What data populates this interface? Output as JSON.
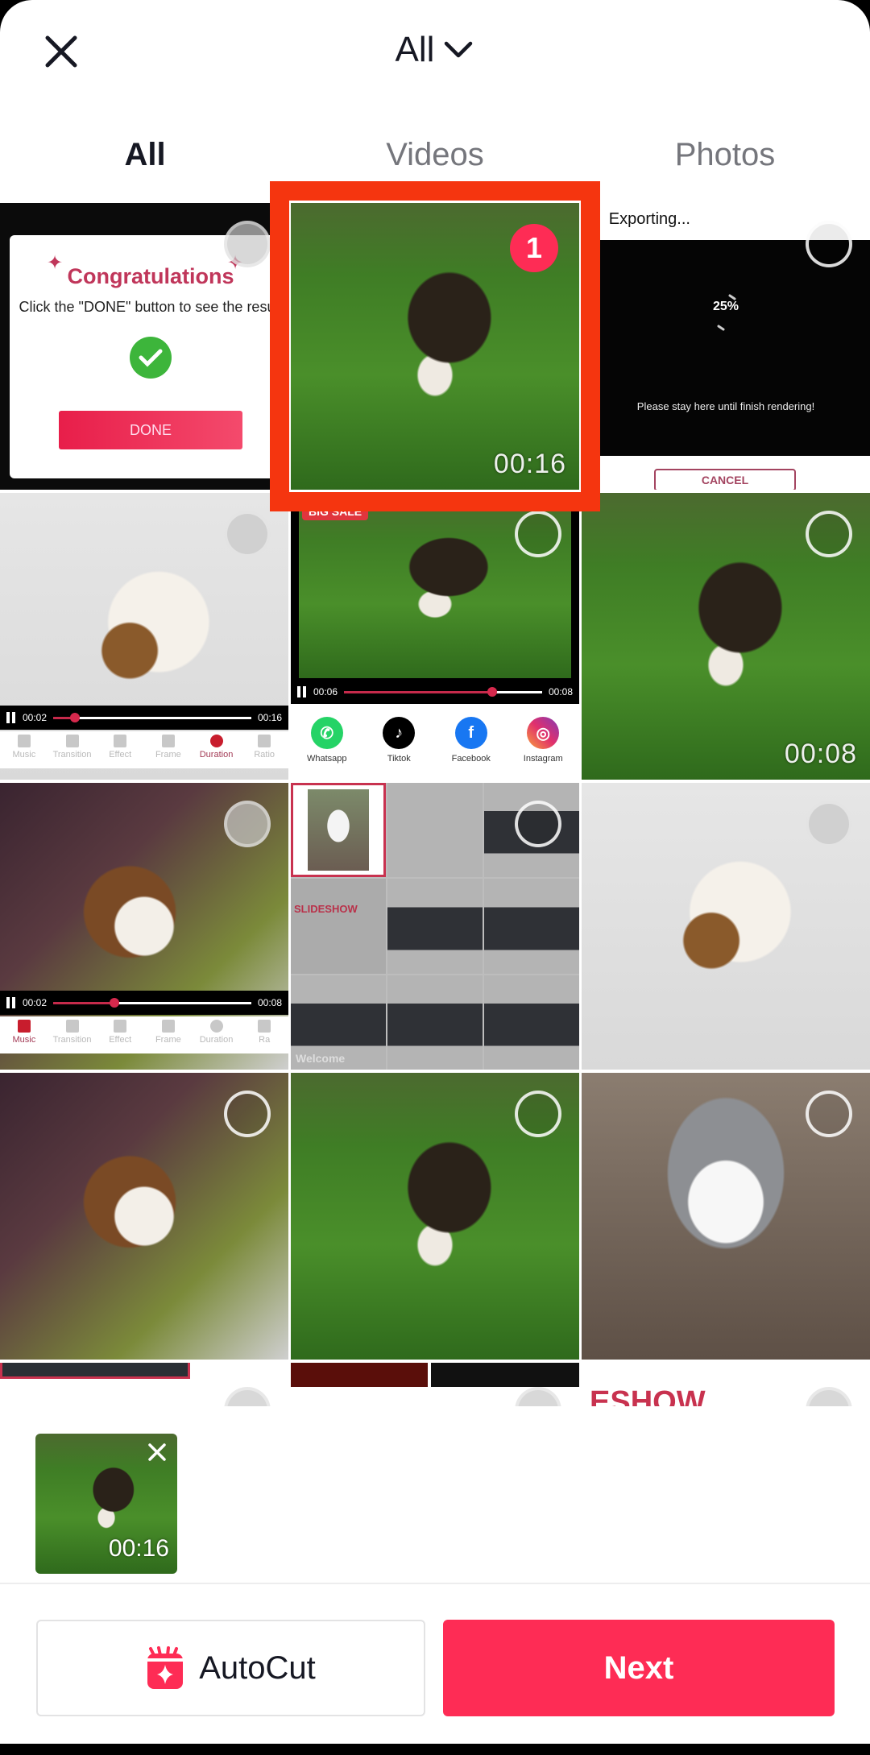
{
  "header": {
    "close_icon": "close-icon",
    "album_title": "All",
    "album_chevron": "chevron-down-icon"
  },
  "tabs": [
    {
      "label": "All",
      "active": true
    },
    {
      "label": "Videos",
      "active": false
    },
    {
      "label": "Photos",
      "active": false
    }
  ],
  "grid": {
    "cells": [
      {
        "type": "screenshot",
        "content": {
          "title": "Congratulations",
          "subtitle": "Click the \"DONE\" button to see the result",
          "button": "DONE"
        },
        "selected": false
      },
      {
        "type": "video",
        "duration": "00:16",
        "selected": true,
        "selection_index": "1"
      },
      {
        "type": "screenshot",
        "content": {
          "header": "Exporting...",
          "progress": "25%",
          "message": "Please stay here until finish rendering!",
          "button": "CANCEL"
        },
        "selected": false
      },
      {
        "type": "screenshot",
        "content": {
          "current_time": "00:02",
          "total_time": "00:16",
          "playback_progress": 0.11,
          "tools": [
            "Music",
            "Transition",
            "Effect",
            "Frame",
            "Duration",
            "Ratio"
          ],
          "active_tool": "Duration"
        },
        "selected": false
      },
      {
        "type": "screenshot",
        "content": {
          "badge": "BIG SALE",
          "current_time": "00:06",
          "total_time": "00:08",
          "playback_progress": 0.75,
          "share_targets": [
            "Whatsapp",
            "Tiktok",
            "Facebook",
            "Instagram"
          ]
        },
        "selected": false
      },
      {
        "type": "video",
        "duration": "00:08",
        "selected": false
      },
      {
        "type": "screenshot",
        "content": {
          "current_time": "00:02",
          "total_time": "00:08",
          "playback_progress": 0.31,
          "tools": [
            "Music",
            "Transition",
            "Effect",
            "Frame",
            "Duration",
            "Ra"
          ],
          "active_tool": "Music"
        },
        "selected": false
      },
      {
        "type": "screenshot",
        "content": {
          "label": "SLIDESHOW",
          "footer": "Welcome"
        },
        "selected": false
      },
      {
        "type": "photo",
        "selected": false
      },
      {
        "type": "photo",
        "selected": false
      },
      {
        "type": "photo",
        "selected": false
      },
      {
        "type": "photo",
        "selected": false
      }
    ],
    "partial_row_text": "ESHOW"
  },
  "tray": {
    "items": [
      {
        "duration": "00:16",
        "remove_icon": "close-icon"
      }
    ]
  },
  "footer": {
    "autocut_label": "AutoCut",
    "next_label": "Next"
  },
  "colors": {
    "accent": "#fe2c55",
    "highlight_box": "#f5350f",
    "text_primary": "#161823",
    "text_secondary": "#75767c"
  }
}
